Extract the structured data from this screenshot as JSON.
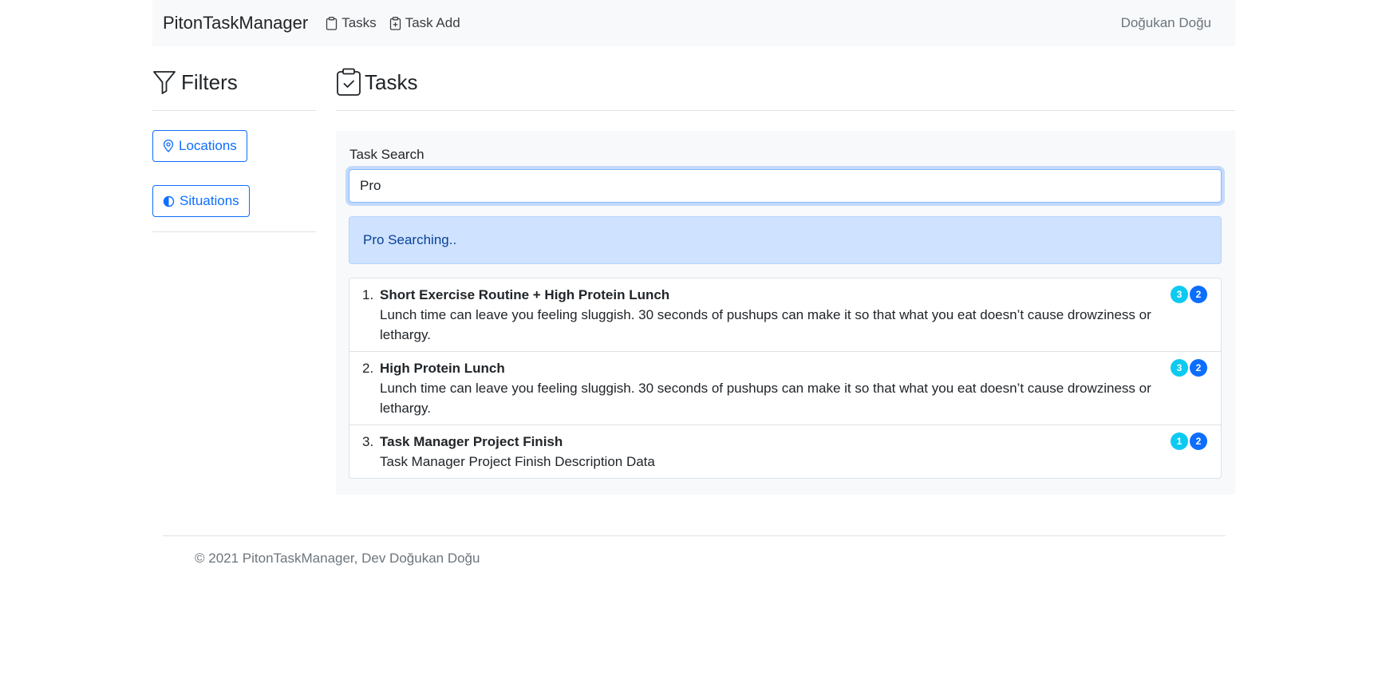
{
  "navbar": {
    "brand": "PitonTaskManager",
    "links": [
      {
        "label": "Tasks",
        "icon": "clipboard-icon"
      },
      {
        "label": "Task Add",
        "icon": "clipboard-plus-icon"
      }
    ],
    "user": "Doğukan Doğu"
  },
  "filters": {
    "title": "Filters",
    "buttons": [
      {
        "label": "Locations",
        "icon": "geo-pin-icon"
      },
      {
        "label": "Situations",
        "icon": "half-circle-icon"
      }
    ]
  },
  "main": {
    "title": "Tasks",
    "search": {
      "label": "Task Search",
      "value": "Pro",
      "status": "Pro Searching.."
    },
    "tasks": [
      {
        "num": "1.",
        "title": "Short Exercise Routine + High Protein Lunch",
        "desc": "Lunch time can leave you feeling sluggish. 30 seconds of pushups can make it so that what you eat doesn’t cause drowziness or lethargy.",
        "badges": [
          "3",
          "2"
        ]
      },
      {
        "num": "2.",
        "title": "High Protein Lunch",
        "desc": "Lunch time can leave you feeling sluggish. 30 seconds of pushups can make it so that what you eat doesn’t cause drowziness or lethargy.",
        "badges": [
          "3",
          "2"
        ]
      },
      {
        "num": "3.",
        "title": "Task Manager Project Finish",
        "desc": "Task Manager Project Finish Description Data",
        "badges": [
          "1",
          "2"
        ]
      }
    ]
  },
  "footer": {
    "text": "© 2021 PitonTaskManager, Dev Doğukan Doğu"
  },
  "colors": {
    "primary": "#0d6efd",
    "info": "#0dcaf0",
    "alert_bg": "#cfe2ff",
    "navbar_bg": "#f8f9fa"
  }
}
